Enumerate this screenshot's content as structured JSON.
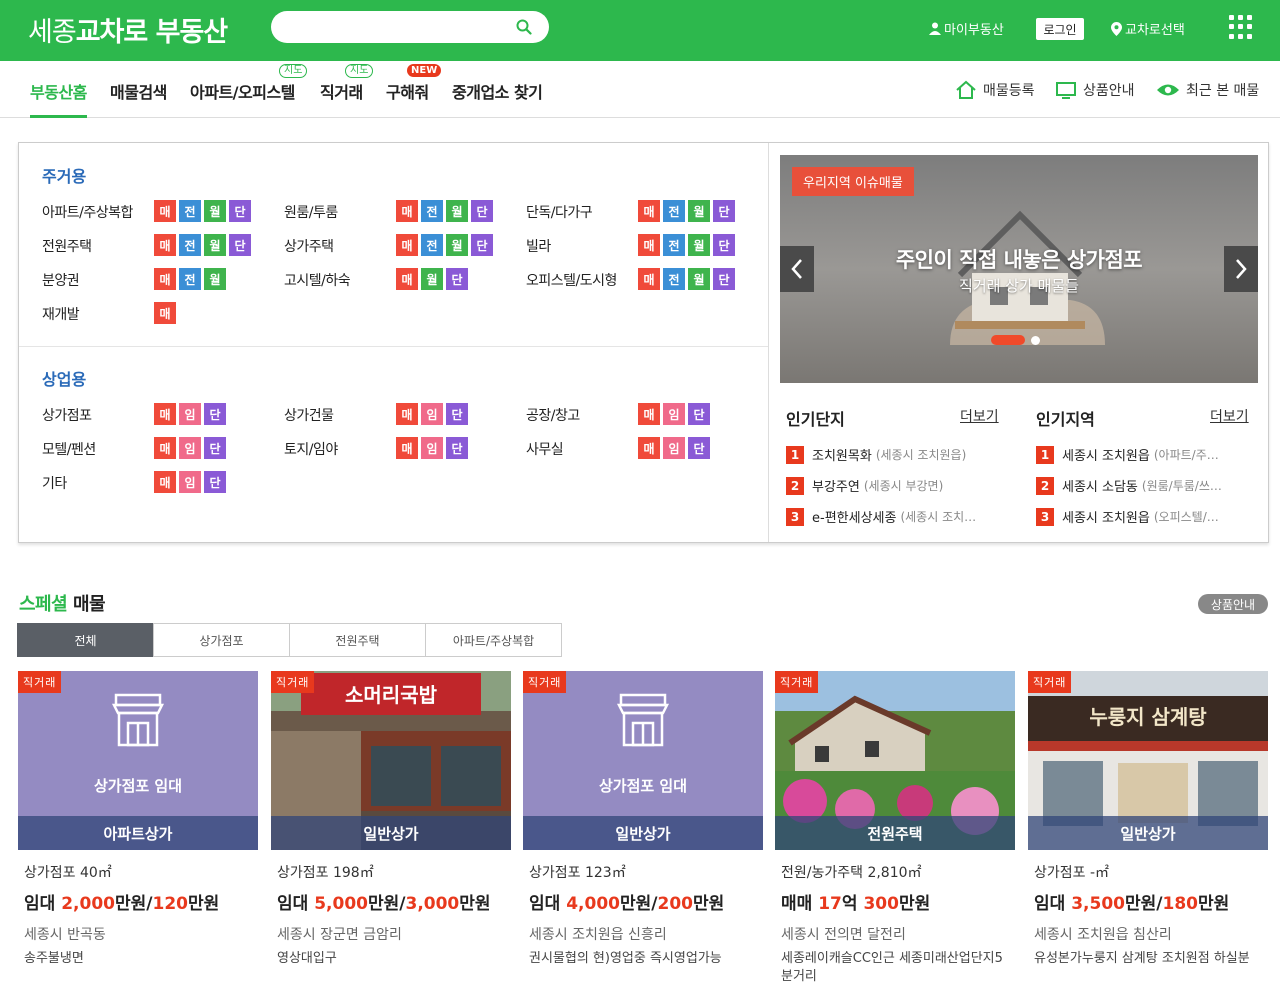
{
  "header": {
    "logo_light": "세종",
    "logo_bold": "교차로 부동산",
    "search_placeholder": "",
    "my_label": "마이부동산",
    "login_label": "로그인",
    "region_label": "교차로선택"
  },
  "nav": {
    "items": [
      "부동산홈",
      "매물검색",
      "아파트/오피스텔",
      "직거래",
      "구해줘",
      "중개업소 찾기"
    ],
    "map_badge": "지도",
    "new_badge": "NEW",
    "right": [
      "매물등록",
      "상품안내",
      "최근 본 매물"
    ]
  },
  "residential": {
    "title": "주거용",
    "rows": [
      {
        "name": "아파트/주상복합",
        "tags": [
          "매",
          "전",
          "월",
          "단"
        ]
      },
      {
        "name": "원룸/투룸",
        "tags": [
          "매",
          "전",
          "월",
          "단"
        ]
      },
      {
        "name": "단독/다가구",
        "tags": [
          "매",
          "전",
          "월",
          "단"
        ]
      },
      {
        "name": "전원주택",
        "tags": [
          "매",
          "전",
          "월",
          "단"
        ]
      },
      {
        "name": "상가주택",
        "tags": [
          "매",
          "전",
          "월",
          "단"
        ]
      },
      {
        "name": "빌라",
        "tags": [
          "매",
          "전",
          "월",
          "단"
        ]
      },
      {
        "name": "분양권",
        "tags": [
          "매",
          "전",
          "월"
        ]
      },
      {
        "name": "고시텔/하숙",
        "tags": [
          "매",
          "월",
          "단"
        ]
      },
      {
        "name": "오피스텔/도시형",
        "tags": [
          "매",
          "전",
          "월",
          "단"
        ]
      },
      {
        "name": "재개발",
        "tags": [
          "매"
        ]
      }
    ]
  },
  "commercial": {
    "title": "상업용",
    "rows": [
      {
        "name": "상가점포",
        "tags": [
          "매",
          "임",
          "단"
        ]
      },
      {
        "name": "상가건물",
        "tags": [
          "매",
          "임",
          "단"
        ]
      },
      {
        "name": "공장/창고",
        "tags": [
          "매",
          "임",
          "단"
        ]
      },
      {
        "name": "모텔/펜션",
        "tags": [
          "매",
          "임",
          "단"
        ]
      },
      {
        "name": "토지/임야",
        "tags": [
          "매",
          "임",
          "단"
        ]
      },
      {
        "name": "사무실",
        "tags": [
          "매",
          "임",
          "단"
        ]
      },
      {
        "name": "기타",
        "tags": [
          "매",
          "임",
          "단"
        ]
      }
    ]
  },
  "banner": {
    "badge": "우리지역 이슈매물",
    "title": "주인이 직접 내놓은 상가점포",
    "subtitle": "직거래 상가 매물들"
  },
  "popular_complex": {
    "title": "인기단지",
    "more": "더보기",
    "items": [
      {
        "rank": "1",
        "name": "조치원목화",
        "sub": "(세종시 조치원읍)"
      },
      {
        "rank": "2",
        "name": "부강주연",
        "sub": "(세종시 부강면)"
      },
      {
        "rank": "3",
        "name": "e-편한세상세종",
        "sub": "(세종시 조치…"
      }
    ]
  },
  "popular_region": {
    "title": "인기지역",
    "more": "더보기",
    "items": [
      {
        "rank": "1",
        "name": "세종시 조치원읍",
        "sub": "(아파트/주…"
      },
      {
        "rank": "2",
        "name": "세종시 소담동",
        "sub": "(원룸/투룸/쓰…"
      },
      {
        "rank": "3",
        "name": "세종시 조치원읍",
        "sub": "(오피스텔/…"
      }
    ]
  },
  "special": {
    "title_green": "스페셜",
    "title_rest": " 매물",
    "product_btn": "상품안내",
    "tabs": [
      "전체",
      "상가점포",
      "전원주택",
      "아파트/주상복합"
    ]
  },
  "cards": [
    {
      "tag": "직거래",
      "overlay": "상가점포 임대",
      "band": "아파트상가",
      "l1": "상가점포 40㎡",
      "p_pre": "임대 ",
      "p1": "2,000",
      "p_mid": "만원/",
      "p2": "120",
      "p_post": "만원",
      "l3": "세종시 반곡동",
      "l4": "송주불냉면"
    },
    {
      "tag": "직거래",
      "overlay": "",
      "band": "일반상가",
      "l1": "상가점포 198㎡",
      "p_pre": "임대 ",
      "p1": "5,000",
      "p_mid": "만원/",
      "p2": "3,000",
      "p_post": "만원",
      "l3": "세종시 장군면 금암리",
      "l4": "영상대입구",
      "sign": "소머리국밥"
    },
    {
      "tag": "직거래",
      "overlay": "상가점포 임대",
      "band": "일반상가",
      "l1": "상가점포 123㎡",
      "p_pre": "임대 ",
      "p1": "4,000",
      "p_mid": "만원/",
      "p2": "200",
      "p_post": "만원",
      "l3": "세종시 조치원읍 신흥리",
      "l4": "권시물협의 현)영업중 즉시영업가능"
    },
    {
      "tag": "직거래",
      "overlay": "",
      "band": "전원주택",
      "l1": "전원/농가주택 2,810㎡",
      "p_pre": "매매 ",
      "p1": "17",
      "p_mid": "억 ",
      "p2": "300",
      "p_post": "만원",
      "l3": "세종시 전의면 달전리",
      "l4": "세종레이캐슬CC인근 세종미래산업단지5분거리"
    },
    {
      "tag": "직거래",
      "overlay": "",
      "band": "일반상가",
      "l1": "상가점포 -㎡",
      "p_pre": "임대 ",
      "p1": "3,500",
      "p_mid": "만원/",
      "p2": "180",
      "p_post": "만원",
      "l3": "세종시 조치원읍 침산리",
      "l4": "유성본가누룽지 삼계탕 조치원점 하실분",
      "sign": "누룽지 삼계탕"
    }
  ]
}
